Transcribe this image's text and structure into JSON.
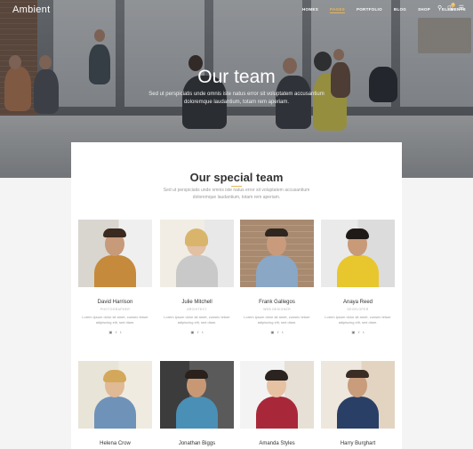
{
  "brand": "Ambient",
  "nav": {
    "items": [
      "HOMES",
      "PAGES",
      "PORTFOLIO",
      "BLOG",
      "SHOP",
      "ELEMENTS"
    ],
    "active": "PAGES",
    "cart_count": "0",
    "icons": [
      "search-icon",
      "cart-icon",
      "menu-icon"
    ]
  },
  "hero": {
    "title": "Our team",
    "subtitle": "Sed ut perspiciatis unde omnis iste natus error sit voluptatem accusantium doloremque laudantium, totam rem aperiam."
  },
  "section": {
    "title": "Our special team",
    "subtitle": "Sed ut perspiciatis unde omnis iste natus error sit voluptatem accusantium doloremque laudantium, totam rem aperiam."
  },
  "members": [
    {
      "name": "David Harrison",
      "role": "PHOTOGRAPHER",
      "desc": "Lorem ipsum dolor sit amet, consec tetuer adipiscing elit, sed diam."
    },
    {
      "name": "Julie Mitchell",
      "role": "ARCHITECT",
      "desc": "Lorem ipsum dolor sit amet, consec tetuer adipiscing elit, sed diam."
    },
    {
      "name": "Frank Gallegos",
      "role": "WEB DESIGNER",
      "desc": "Lorem ipsum dolor sit amet, consec tetuer adipiscing elit, sed diam."
    },
    {
      "name": "Anaya Reed",
      "role": "DEVELOPER",
      "desc": "Lorem ipsum dolor sit amet, consec tetuer adipiscing elit, sed diam."
    },
    {
      "name": "Helena Crow",
      "role": "",
      "desc": ""
    },
    {
      "name": "Jonathan Biggs",
      "role": "",
      "desc": ""
    },
    {
      "name": "Amanda Styles",
      "role": "",
      "desc": ""
    },
    {
      "name": "Harry Burghart",
      "role": "",
      "desc": ""
    }
  ],
  "social_icons": [
    "instagram-icon",
    "facebook-icon",
    "twitter-icon"
  ],
  "social_glyphs": [
    "▣",
    "f",
    "t"
  ]
}
